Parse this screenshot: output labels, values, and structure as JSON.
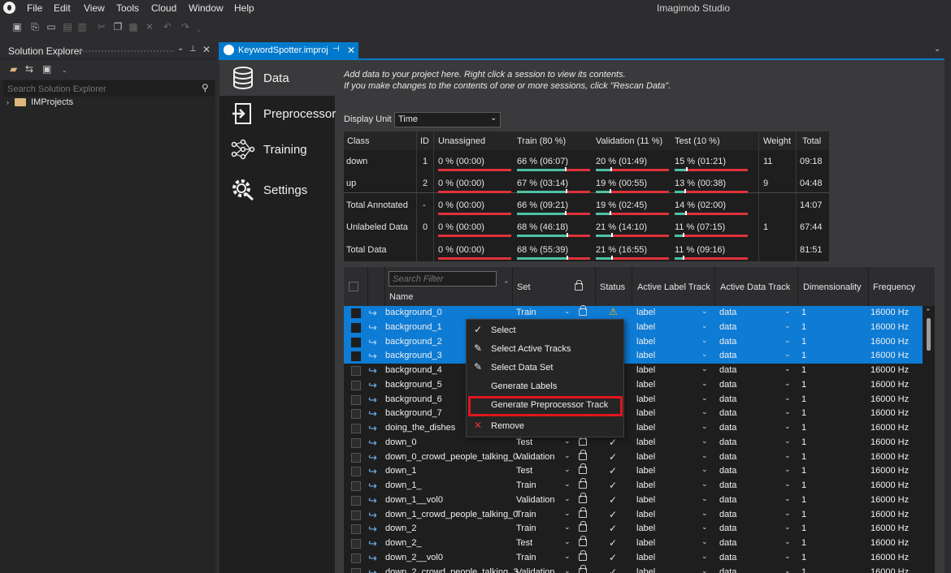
{
  "app_title": "Imagimob Studio",
  "menu": [
    "File",
    "Edit",
    "View",
    "Tools",
    "Cloud",
    "Window",
    "Help"
  ],
  "solution_explorer": {
    "title": "Solution Explorer",
    "search_placeholder": "Search Solution Explorer",
    "tree": [
      {
        "label": "IMProjects"
      }
    ]
  },
  "document_tab": {
    "title": "KeywordSpotter.improj",
    "pin_icon": "pin-icon",
    "close_icon": "close-icon"
  },
  "nav": [
    {
      "label": "Data",
      "icon": "database-icon",
      "selected": true
    },
    {
      "label": "Preprocessor",
      "icon": "preprocessor-icon",
      "selected": false
    },
    {
      "label": "Training",
      "icon": "training-icon",
      "selected": false
    },
    {
      "label": "Settings",
      "icon": "settings-icon",
      "selected": false
    }
  ],
  "info_line1": "Add data to your project here. Right click a session to view its contents.",
  "info_line2": "If you make changes to the contents of one or more sessions, click \"Rescan Data\".",
  "display_unit": {
    "label": "Display Unit",
    "value": "Time"
  },
  "summary": {
    "headers": [
      "Class",
      "ID",
      "Unassigned",
      "Train (80 %)",
      "Validation (11 %)",
      "Test (10 %)",
      "Weight",
      "Total"
    ],
    "rows": [
      {
        "cls": "down",
        "id": "1",
        "unassigned": "0 %  (00:00)",
        "train": "66 %  (06:07)",
        "train_pct": 66,
        "validation": "20 %  (01:49)",
        "val_pct": 20,
        "test": "15 %  (01:21)",
        "test_pct": 15,
        "weight": "11",
        "total": "09:18"
      },
      {
        "cls": "up",
        "id": "2",
        "unassigned": "0 %  (00:00)",
        "train": "67 %  (03:14)",
        "train_pct": 67,
        "validation": "19 %  (00:55)",
        "val_pct": 19,
        "test": "13 %  (00:38)",
        "test_pct": 13,
        "weight": "9",
        "total": "04:48"
      },
      {
        "cls": "Total Annotated",
        "id": "-",
        "unassigned": "0 %  (00:00)",
        "train": "66 %  (09:21)",
        "train_pct": 66,
        "validation": "19 %  (02:45)",
        "val_pct": 19,
        "test": "14 %  (02:00)",
        "test_pct": 14,
        "weight": "",
        "total": "14:07"
      },
      {
        "cls": "Unlabeled Data",
        "id": "0",
        "unassigned": "0 %  (00:00)",
        "train": "68 %  (46:18)",
        "train_pct": 68,
        "validation": "21 %  (14:10)",
        "val_pct": 21,
        "test": "11 %  (07:15)",
        "test_pct": 11,
        "weight": "1",
        "total": "67:44"
      },
      {
        "cls": "Total Data",
        "id": "",
        "unassigned": "0 %  (00:00)",
        "train": "68 %  (55:39)",
        "train_pct": 68,
        "validation": "21 %  (16:55)",
        "val_pct": 21,
        "test": "11 %  (09:16)",
        "test_pct": 11,
        "weight": "",
        "total": "81:51"
      }
    ]
  },
  "grid": {
    "search_filter": "Search Filter",
    "headers": {
      "name": "Name",
      "set": "Set",
      "status": "Status",
      "label_track": "Active Label Track",
      "data_track": "Active Data Track",
      "dimensionality": "Dimensionality",
      "frequency": "Frequency"
    },
    "rows": [
      {
        "name": "background_0",
        "set": "Train",
        "status": "warning",
        "label": "label",
        "data": "data",
        "dim": "1",
        "freq": "16000 Hz",
        "selected": true
      },
      {
        "name": "background_1",
        "set": "",
        "status": "",
        "label": "label",
        "data": "data",
        "dim": "1",
        "freq": "16000 Hz",
        "selected": true
      },
      {
        "name": "background_2",
        "set": "",
        "status": "",
        "label": "label",
        "data": "data",
        "dim": "1",
        "freq": "16000 Hz",
        "selected": true
      },
      {
        "name": "background_3",
        "set": "",
        "status": "",
        "label": "label",
        "data": "data",
        "dim": "1",
        "freq": "16000 Hz",
        "selected": true
      },
      {
        "name": "background_4",
        "set": "",
        "status": "",
        "label": "label",
        "data": "data",
        "dim": "1",
        "freq": "16000 Hz",
        "selected": false
      },
      {
        "name": "background_5",
        "set": "",
        "status": "",
        "label": "label",
        "data": "data",
        "dim": "1",
        "freq": "16000 Hz",
        "selected": false
      },
      {
        "name": "background_6",
        "set": "",
        "status": "",
        "label": "label",
        "data": "data",
        "dim": "1",
        "freq": "16000 Hz",
        "selected": false
      },
      {
        "name": "background_7",
        "set": "",
        "status": "",
        "label": "label",
        "data": "data",
        "dim": "1",
        "freq": "16000 Hz",
        "selected": false
      },
      {
        "name": "doing_the_dishes",
        "set": "",
        "status": "",
        "label": "label",
        "data": "data",
        "dim": "1",
        "freq": "16000 Hz",
        "selected": false
      },
      {
        "name": "down_0",
        "set": "Test",
        "status": "ok",
        "label": "label",
        "data": "data",
        "dim": "1",
        "freq": "16000 Hz",
        "selected": false
      },
      {
        "name": "down_0_crowd_people_talking_0",
        "set": "Validation",
        "status": "ok",
        "label": "label",
        "data": "data",
        "dim": "1",
        "freq": "16000 Hz",
        "selected": false
      },
      {
        "name": "down_1",
        "set": "Test",
        "status": "ok",
        "label": "label",
        "data": "data",
        "dim": "1",
        "freq": "16000 Hz",
        "selected": false
      },
      {
        "name": "down_1_",
        "set": "Train",
        "status": "ok",
        "label": "label",
        "data": "data",
        "dim": "1",
        "freq": "16000 Hz",
        "selected": false
      },
      {
        "name": "down_1__vol0",
        "set": "Validation",
        "status": "ok",
        "label": "label",
        "data": "data",
        "dim": "1",
        "freq": "16000 Hz",
        "selected": false
      },
      {
        "name": "down_1_crowd_people_talking_0",
        "set": "Train",
        "status": "ok",
        "label": "label",
        "data": "data",
        "dim": "1",
        "freq": "16000 Hz",
        "selected": false
      },
      {
        "name": "down_2",
        "set": "Train",
        "status": "ok",
        "label": "label",
        "data": "data",
        "dim": "1",
        "freq": "16000 Hz",
        "selected": false
      },
      {
        "name": "down_2_",
        "set": "Test",
        "status": "ok",
        "label": "label",
        "data": "data",
        "dim": "1",
        "freq": "16000 Hz",
        "selected": false
      },
      {
        "name": "down_2__vol0",
        "set": "Train",
        "status": "ok",
        "label": "label",
        "data": "data",
        "dim": "1",
        "freq": "16000 Hz",
        "selected": false
      },
      {
        "name": "down_2_crowd_people_talking_3",
        "set": "Validation",
        "status": "ok",
        "label": "label",
        "data": "data",
        "dim": "1",
        "freq": "16000 Hz",
        "selected": false
      }
    ]
  },
  "context_menu": [
    {
      "label": "Select",
      "icon": "check-icon"
    },
    {
      "label": "Select Active Tracks",
      "icon": "pencil-icon"
    },
    {
      "label": "Select Data Set",
      "icon": "pencil-icon"
    },
    {
      "label": "Generate Labels",
      "icon": ""
    },
    {
      "label": "Generate Preprocessor Track",
      "icon": "",
      "highlighted": true
    },
    {
      "label": "Remove",
      "icon": "remove-icon"
    }
  ],
  "colors": {
    "accent": "#007acc",
    "selection": "#0e7bd4",
    "train_bar": "#4fc1a6",
    "remaining_bar": "#e0323a",
    "highlight": "#e0161b"
  }
}
